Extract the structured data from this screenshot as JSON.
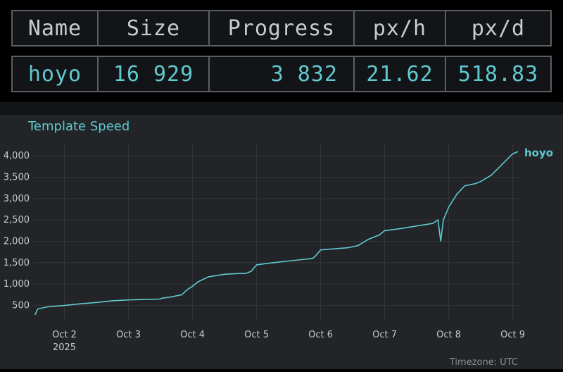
{
  "stats_table": {
    "headers": [
      "Name",
      "Size",
      "Progress",
      "px/h",
      "px/d"
    ],
    "row": [
      "hoyo",
      "16 929",
      "3 832",
      "21.62",
      "518.83"
    ]
  },
  "chart_data": {
    "type": "line",
    "title": "Template Speed",
    "xlabel": "",
    "ylabel": "",
    "x_tick_labels": [
      "Oct 2",
      "Oct 3",
      "Oct 4",
      "Oct 5",
      "Oct 6",
      "Oct 7",
      "Oct 8",
      "Oct 9"
    ],
    "x_tick_year": "2025",
    "x_range": [
      "2025-10-01T12:00",
      "2025-10-09T03:00"
    ],
    "ylim": [
      180,
      4300
    ],
    "y_ticks": [
      500,
      1000,
      1500,
      2000,
      2500,
      3000,
      3500,
      4000
    ],
    "y_tick_labels": [
      "500",
      "1,000",
      "1,500",
      "2,000",
      "2,500",
      "3,000",
      "3,500",
      "4,000"
    ],
    "grid": true,
    "footer": "Timezone: UTC",
    "colors": {
      "line": "#5fc9cf",
      "background": "#222428",
      "grid": "#34363a"
    },
    "series": [
      {
        "name": "hoyo",
        "x": [
          "2025-10-01T13:00",
          "2025-10-01T14:00",
          "2025-10-01T18:00",
          "2025-10-02T00:00",
          "2025-10-02T06:00",
          "2025-10-02T12:00",
          "2025-10-02T18:00",
          "2025-10-03T00:00",
          "2025-10-03T06:00",
          "2025-10-03T12:00",
          "2025-10-03T12:30",
          "2025-10-03T16:00",
          "2025-10-03T20:00",
          "2025-10-03T22:00",
          "2025-10-04T00:00",
          "2025-10-04T02:00",
          "2025-10-04T06:00",
          "2025-10-04T12:00",
          "2025-10-04T18:00",
          "2025-10-04T20:00",
          "2025-10-04T22:00",
          "2025-10-05T00:00",
          "2025-10-05T06:00",
          "2025-10-05T12:00",
          "2025-10-05T18:00",
          "2025-10-05T21:00",
          "2025-10-05T22:00",
          "2025-10-06T00:00",
          "2025-10-06T06:00",
          "2025-10-06T10:00",
          "2025-10-06T14:00",
          "2025-10-06T18:00",
          "2025-10-06T22:00",
          "2025-10-07T00:00",
          "2025-10-07T06:00",
          "2025-10-07T12:00",
          "2025-10-07T18:00",
          "2025-10-07T20:00",
          "2025-10-07T21:00",
          "2025-10-07T22:00",
          "2025-10-08T00:00",
          "2025-10-08T03:00",
          "2025-10-08T06:00",
          "2025-10-08T10:00",
          "2025-10-08T12:00",
          "2025-10-08T16:00",
          "2025-10-08T20:00",
          "2025-10-09T00:00",
          "2025-10-09T02:00"
        ],
        "y": [
          280,
          420,
          470,
          500,
          540,
          570,
          610,
          630,
          640,
          650,
          670,
          700,
          750,
          870,
          950,
          1050,
          1170,
          1230,
          1250,
          1250,
          1300,
          1450,
          1500,
          1540,
          1580,
          1600,
          1650,
          1800,
          1830,
          1850,
          1900,
          2050,
          2150,
          2250,
          2300,
          2360,
          2420,
          2500,
          2000,
          2500,
          2800,
          3100,
          3300,
          3350,
          3400,
          3550,
          3800,
          4050,
          4100
        ]
      }
    ]
  }
}
